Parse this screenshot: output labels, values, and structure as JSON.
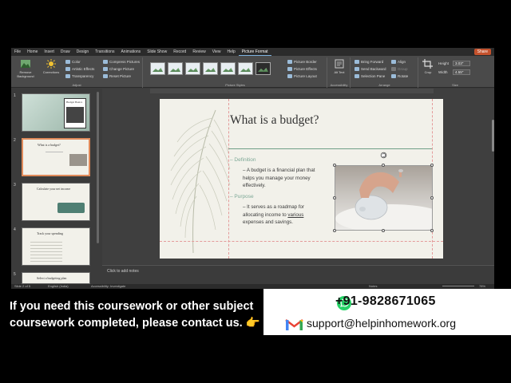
{
  "menubar": {
    "tabs": [
      "File",
      "Home",
      "Insert",
      "Draw",
      "Design",
      "Transitions",
      "Animations",
      "Slide Show",
      "Record",
      "Review",
      "View",
      "Help",
      "Picture Format"
    ],
    "active_tab": "Picture Format",
    "share_label": "Share"
  },
  "ribbon": {
    "remove_background": "Remove Background",
    "corrections": "Corrections",
    "color": "Color",
    "artistic_effects": "Artistic Effects",
    "transparency": "Transparency",
    "compress_pictures": "Compress Pictures",
    "change_picture": "Change Picture",
    "reset_picture": "Reset Picture",
    "adjust_group": "Adjust",
    "picture_styles_group": "Picture Styles",
    "picture_border": "Picture Border",
    "picture_effects": "Picture Effects",
    "picture_layout": "Picture Layout",
    "alt_text": "Alt Text",
    "accessibility_group": "Accessibility",
    "bring_forward": "Bring Forward",
    "send_backward": "Send Backward",
    "selection_pane": "Selection Pane",
    "align": "Align",
    "group": "Group",
    "rotate": "Rotate",
    "arrange_group": "Arrange",
    "crop": "Crop",
    "height_label": "Height",
    "height_value": "3.03\"",
    "width_label": "Width",
    "width_value": "4.55\"",
    "size_group": "Size"
  },
  "thumbnails": [
    {
      "num": "1",
      "title": "Budget Basics"
    },
    {
      "num": "2",
      "title": "What is a budget?"
    },
    {
      "num": "3",
      "title": "Calculate your net income"
    },
    {
      "num": "4",
      "title": "Track your spending"
    },
    {
      "num": "5",
      "title": "Select a budgeting plan"
    }
  ],
  "slide": {
    "title": "What is a budget?",
    "section1_heading": "Definition",
    "section1_text": "A budget is a financial plan that helps you manage your money effectively.",
    "section2_heading": "Purpose",
    "section2_text_pre": "It serves as a roadmap for allocating income to various ",
    "section2_text_underlined": "various",
    "section2_text_post": " expenses and savings."
  },
  "notes_placeholder": "Click to add notes",
  "statusbar": {
    "slide_count": "Slide 2 of 5",
    "language": "English (India)",
    "accessibility": "Accessibility: Investigate",
    "notes": "Notes",
    "zoom": "78%"
  },
  "banner": {
    "line1": "If you need this coursework or other subject",
    "line2": "coursework completed, please contact us. 👉",
    "phone": "+91-9828671065",
    "email": "support@helpinhomework.org"
  }
}
